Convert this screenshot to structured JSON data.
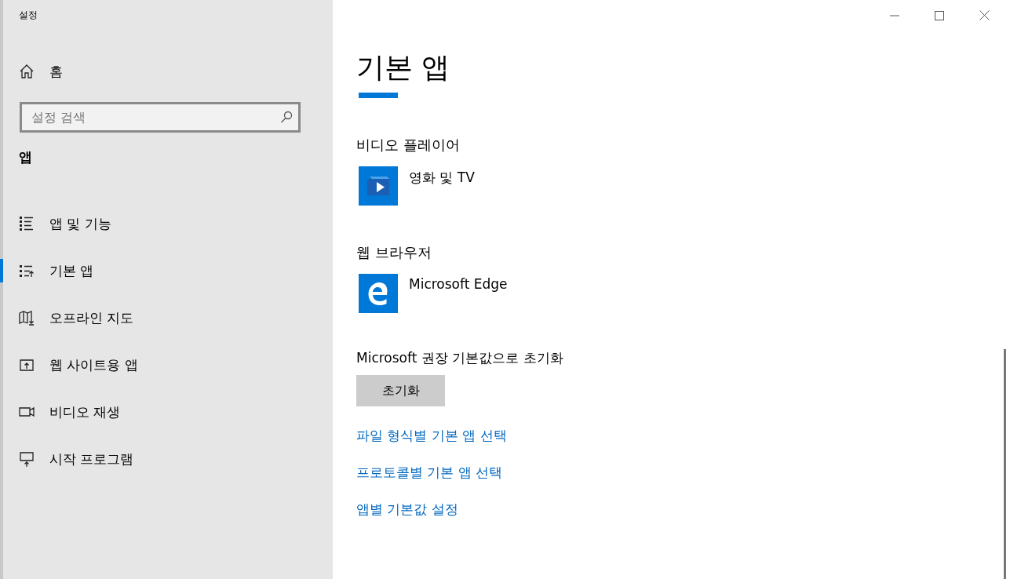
{
  "window": {
    "title": "설정"
  },
  "sidebar": {
    "home": "홈",
    "search": {
      "placeholder": "설정 검색"
    },
    "section": "앱",
    "items": [
      {
        "label": "앱 및 기능",
        "kind": "list",
        "selected": false
      },
      {
        "label": "기본 앱",
        "kind": "defaults",
        "selected": true
      },
      {
        "label": "오프라인 지도",
        "kind": "map",
        "selected": false
      },
      {
        "label": "웹 사이트용 앱",
        "kind": "upload",
        "selected": false
      },
      {
        "label": "비디오 재생",
        "kind": "camera",
        "selected": false
      },
      {
        "label": "시작 프로그램",
        "kind": "startup",
        "selected": false
      }
    ]
  },
  "main": {
    "title": "기본 앱",
    "defaults": [
      {
        "heading": "비디오 플레이어",
        "app": {
          "name": "영화 및 TV",
          "kind": "movies"
        }
      },
      {
        "heading": "웹 브라우저",
        "app": {
          "name": "Microsoft Edge",
          "kind": "edge"
        }
      }
    ],
    "reset": {
      "label": "Microsoft 권장 기본값으로 초기화",
      "button": "초기화"
    },
    "links": [
      "파일 형식별 기본 앱 선택",
      "프로토콜별 기본 앱 선택",
      "앱별 기본값 설정"
    ]
  }
}
